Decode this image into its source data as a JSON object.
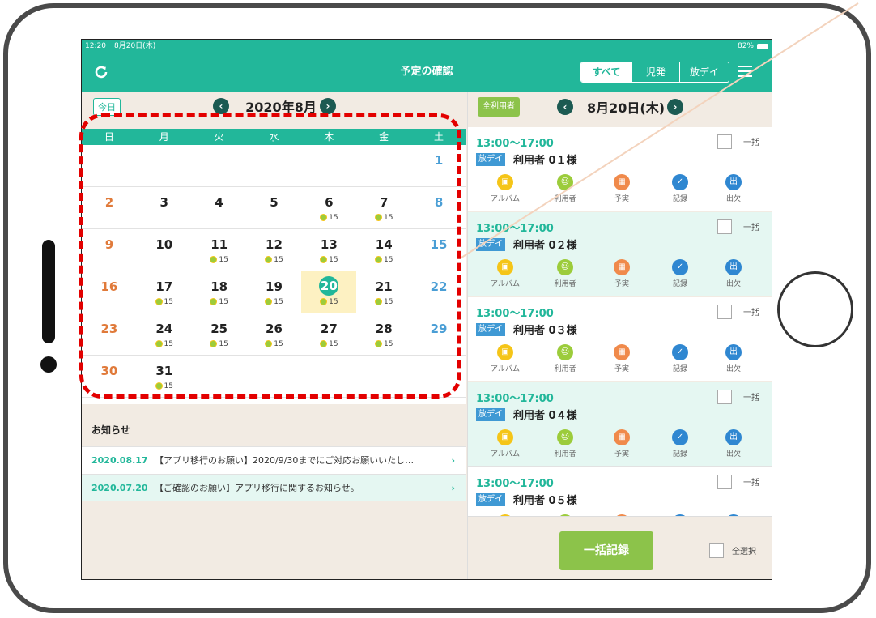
{
  "status": {
    "time": "12:20",
    "date": "8月20日(木)",
    "battery": "82%"
  },
  "nav": {
    "title": "予定の確認",
    "tabs": [
      "すべて",
      "児発",
      "放デイ"
    ],
    "active_tab": "すべて"
  },
  "calendar": {
    "today_label": "今日",
    "month_title": "2020年8月",
    "weekdays": [
      "日",
      "月",
      "火",
      "水",
      "木",
      "金",
      "土"
    ],
    "selected_day": "20",
    "badge_count": "15",
    "weeks": [
      [
        {
          "d": ""
        },
        {
          "d": ""
        },
        {
          "d": ""
        },
        {
          "d": ""
        },
        {
          "d": ""
        },
        {
          "d": ""
        },
        {
          "d": "1"
        }
      ],
      [
        {
          "d": "2"
        },
        {
          "d": "3"
        },
        {
          "d": "4"
        },
        {
          "d": "5"
        },
        {
          "d": "6",
          "b": "15"
        },
        {
          "d": "7",
          "b": "15"
        },
        {
          "d": "8"
        }
      ],
      [
        {
          "d": "9"
        },
        {
          "d": "10"
        },
        {
          "d": "11",
          "b": "15"
        },
        {
          "d": "12",
          "b": "15"
        },
        {
          "d": "13",
          "b": "15"
        },
        {
          "d": "14",
          "b": "15"
        },
        {
          "d": "15"
        }
      ],
      [
        {
          "d": "16"
        },
        {
          "d": "17",
          "b": "15"
        },
        {
          "d": "18",
          "b": "15"
        },
        {
          "d": "19",
          "b": "15"
        },
        {
          "d": "20",
          "b": "15"
        },
        {
          "d": "21",
          "b": "15"
        },
        {
          "d": "22"
        }
      ],
      [
        {
          "d": "23"
        },
        {
          "d": "24",
          "b": "15"
        },
        {
          "d": "25",
          "b": "15"
        },
        {
          "d": "26",
          "b": "15"
        },
        {
          "d": "27",
          "b": "15"
        },
        {
          "d": "28",
          "b": "15"
        },
        {
          "d": "29"
        }
      ],
      [
        {
          "d": "30"
        },
        {
          "d": "31",
          "b": "15"
        },
        {
          "d": ""
        },
        {
          "d": ""
        },
        {
          "d": ""
        },
        {
          "d": ""
        },
        {
          "d": ""
        }
      ]
    ]
  },
  "notices": {
    "title": "お知らせ",
    "items": [
      {
        "date": "2020.08.17",
        "text": "【アプリ移行のお願い】2020/9/30までにご対応お願いいたし…"
      },
      {
        "date": "2020.07.20",
        "text": "【ご確認のお願い】アプリ移行に関するお知らせ。"
      }
    ]
  },
  "schedule": {
    "all_users_label": "全利用者",
    "date_title": "8月20日(木)",
    "bulk_check_label": "一括",
    "action_labels": [
      "アルバム",
      "利用者",
      "予実",
      "記録",
      "出欠"
    ],
    "entries": [
      {
        "time": "13:00〜17:00",
        "tag": "放デイ",
        "name": "利用者 0１様"
      },
      {
        "time": "13:00〜17:00",
        "tag": "放デイ",
        "name": "利用者 0２様"
      },
      {
        "time": "13:00〜17:00",
        "tag": "放デイ",
        "name": "利用者 0３様"
      },
      {
        "time": "13:00〜17:00",
        "tag": "放デイ",
        "name": "利用者 0４様"
      },
      {
        "time": "13:00〜17:00",
        "tag": "放デイ",
        "name": "利用者 0５様"
      }
    ],
    "bulk_record_label": "一括記録",
    "select_all_label": "全選択"
  },
  "colors": {
    "accent": "#22b79a",
    "green_button": "#8cc34a",
    "highlight": "#e30000"
  }
}
